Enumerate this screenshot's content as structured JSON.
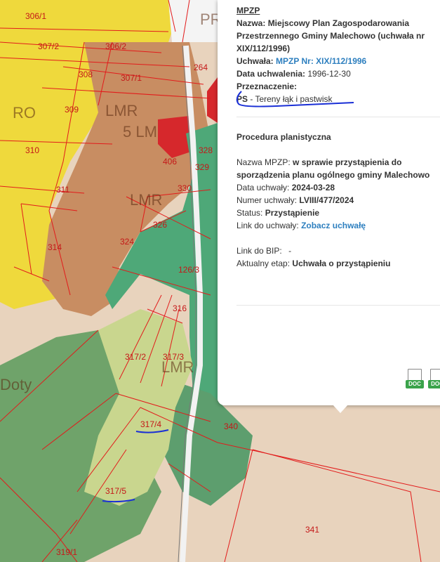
{
  "map": {
    "plots": [
      "306/1",
      "307/2",
      "306/2",
      "308",
      "307/1",
      "264",
      "309",
      "310",
      "311",
      "314",
      "406",
      "328",
      "329",
      "330",
      "326",
      "324",
      "126/3",
      "316",
      "317/2",
      "317/3",
      "317/4",
      "317/5",
      "340",
      "341",
      "319/1"
    ],
    "zones": [
      "RO",
      "LMR",
      "5 LM",
      "LMR",
      "LMR",
      "PR",
      "Doty"
    ],
    "colors": {
      "yellow": "#f0dc3c",
      "brown": "#c48a5c",
      "green": "#4fa87a",
      "lightgreen": "#c4d38a",
      "red": "#d6282c",
      "beige": "#e8d3bd",
      "plotline": "#e21b1b",
      "annotation": "#1a2fd6"
    }
  },
  "popup": {
    "header": "MPZP",
    "name_label": "Nazwa:",
    "name_value": "Miejscowy Plan Zagospodarowania Przestrzennego Gminy Malechowo (uchwała nr XIX/112/1996)",
    "resolution_label": "Uchwała:",
    "resolution_value": "MPZP Nr: XIX/112/1996",
    "adopted_label": "Data uchwalenia:",
    "adopted_value": "1996-12-30",
    "purpose_label": "Przeznaczenie:",
    "purpose_code": "PS",
    "purpose_desc": " - Tereny łąk i pastwisk",
    "procedure_title": "Procedura planistyczna",
    "proc_name_label": "Nazwa MPZP:",
    "proc_name_value": "w sprawie przystąpienia do sporządzenia planu ogólnego gminy Malechowo",
    "date_label": "Data uchwały:",
    "date_value": "2024-03-28",
    "number_label": "Numer uchwały:",
    "number_value": "LVIII/477/2024",
    "status_label": "Status:",
    "status_value": "Przystąpienie",
    "link_label": "Link do uchwały:",
    "link_value": "Zobacz uchwałę",
    "bip_label": "Link do BIP:",
    "bip_value": "-",
    "stage_label": "Aktualny etap:",
    "stage_value": "Uchwała o przystąpieniu",
    "doc_icons": [
      {
        "icon": "doc-file-icon",
        "tag": "DOC"
      },
      {
        "icon": "doc-file-icon",
        "tag": "DOC"
      }
    ]
  }
}
